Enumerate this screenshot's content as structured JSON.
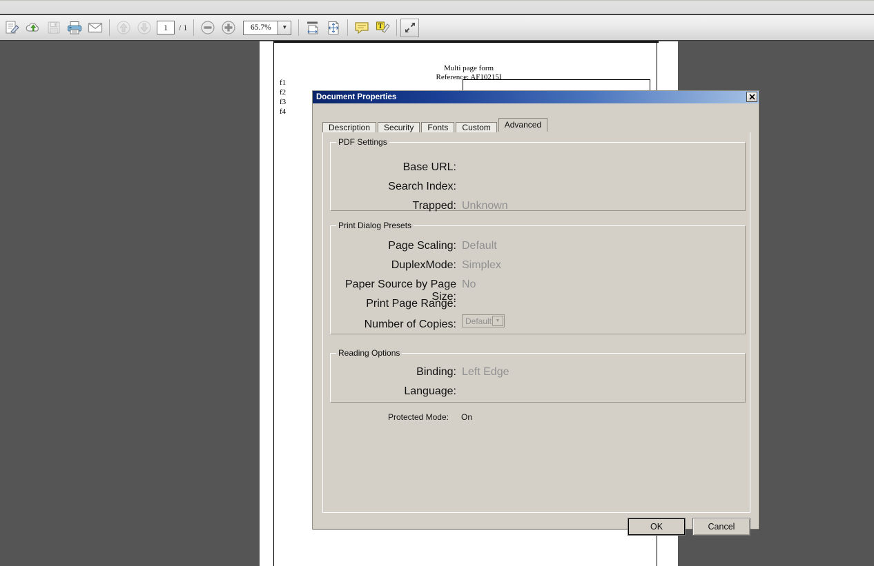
{
  "toolbar": {
    "buttons": [
      {
        "name": "sign-document-icon",
        "title": "Sign",
        "enabled": true
      },
      {
        "name": "cloud-upload-icon",
        "title": "Upload to cloud",
        "enabled": true
      },
      {
        "name": "save-icon",
        "title": "Save",
        "enabled": false
      },
      {
        "name": "print-icon",
        "title": "Print",
        "enabled": true
      },
      {
        "name": "email-icon",
        "title": "Email",
        "enabled": true
      }
    ],
    "prev_page_label": "previous-page",
    "next_page_label": "next-page",
    "page_number": "1",
    "page_total": "/ 1",
    "zoom_out_label": "zoom-out",
    "zoom_in_label": "zoom-in",
    "zoom_value": "65.7%",
    "zoom_dropdown_glyph": "▼",
    "right_buttons": [
      {
        "name": "fit-width-icon",
        "title": "Fit width"
      },
      {
        "name": "fit-page-icon",
        "title": "Fit page"
      },
      {
        "name": "comment-icon",
        "title": "Comment"
      },
      {
        "name": "text-highlight-icon",
        "title": "Typewriter / highlight"
      },
      {
        "name": "fullscreen-icon",
        "title": "Full screen"
      }
    ]
  },
  "document": {
    "title": "Multi page form",
    "reference": "Reference: AF10215I",
    "field_labels": [
      "f1",
      "f2",
      "f3",
      "f4"
    ]
  },
  "dialog": {
    "title": "Document Properties",
    "close_glyph": "✕",
    "tabs": [
      {
        "label": "Description",
        "active": false
      },
      {
        "label": "Security",
        "active": false
      },
      {
        "label": "Fonts",
        "active": false
      },
      {
        "label": "Custom",
        "active": false
      },
      {
        "label": "Advanced",
        "active": true
      }
    ],
    "pdf_settings": {
      "title": "PDF Settings",
      "rows": [
        {
          "label": "Base URL:",
          "value": ""
        },
        {
          "label": "Search Index:",
          "value": ""
        },
        {
          "label": "Trapped:",
          "value": "Unknown"
        }
      ]
    },
    "print_presets": {
      "title": "Print Dialog Presets",
      "rows": [
        {
          "label": "Page Scaling:",
          "value": "Default"
        },
        {
          "label": "DuplexMode:",
          "value": "Simplex"
        },
        {
          "label": "Paper Source by Page Size:",
          "value": "No"
        },
        {
          "label": "Print Page Range:",
          "value": ""
        }
      ],
      "copies_label": "Number of Copies:",
      "copies_value": "Default",
      "copies_arrow": "▼"
    },
    "reading_options": {
      "title": "Reading Options",
      "rows": [
        {
          "label": "Binding:",
          "value": "Left Edge"
        },
        {
          "label": "Language:",
          "value": ""
        }
      ]
    },
    "protected_mode": {
      "label": "Protected Mode:",
      "value": "On"
    },
    "ok_label": "OK",
    "cancel_label": "Cancel"
  },
  "colors": {
    "dialog_face": "#d4d0c8",
    "titlebar_start": "#0a246a",
    "titlebar_end": "#a6c2e4",
    "viewer_bg": "#555555",
    "disabled_text": "#919191"
  }
}
